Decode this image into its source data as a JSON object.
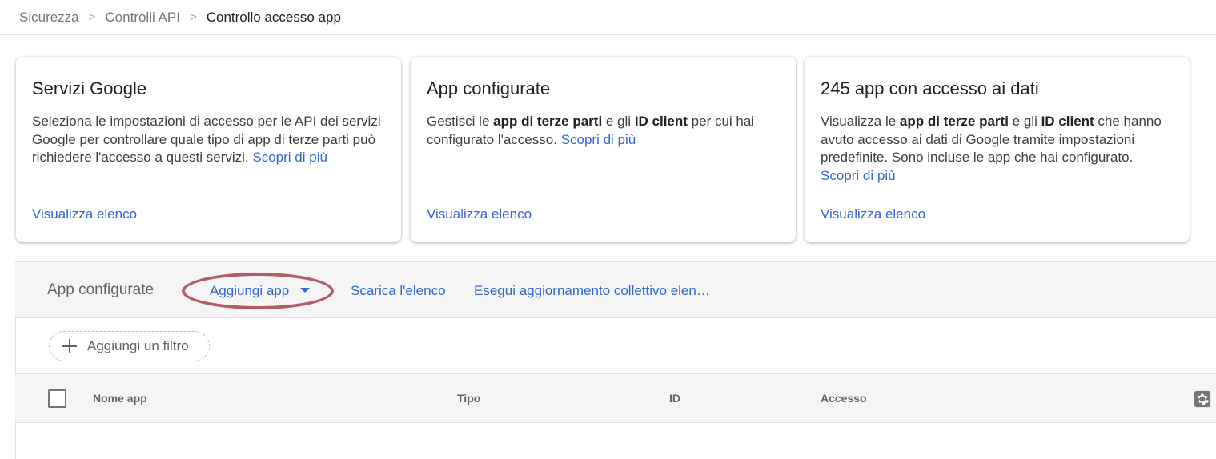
{
  "breadcrumb": {
    "items": [
      "Sicurezza",
      "Controlli API",
      "Controllo accesso app"
    ],
    "separator": ">"
  },
  "cards": [
    {
      "title": "Servizi Google",
      "body": "Seleziona le impostazioni di accesso per le API dei servizi Google per controllare quale tipo di app di terze parti può richiedere l'accesso a questi servizi.",
      "learn_more": "Scopri di più",
      "footer_link": "Visualizza elenco"
    },
    {
      "title": "App configurate",
      "body_pre": "Gestisci le ",
      "body_bold1": "app di terze parti",
      "body_mid": " e gli ",
      "body_bold2": "ID client",
      "body_post": " per cui hai configurato l'accesso.",
      "learn_more": "Scopri di più",
      "footer_link": "Visualizza elenco"
    },
    {
      "title": "245 app con accesso ai dati",
      "body_pre": "Visualizza le ",
      "body_bold1": "app di terze parti",
      "body_mid": " e gli ",
      "body_bold2": "ID client",
      "body_post": " che hanno avuto accesso ai dati di Google tramite impostazioni predefinite. Sono incluse le app che hai configurato.",
      "learn_more": "Scopri di più",
      "footer_link": "Visualizza elenco"
    }
  ],
  "panel": {
    "title": "App configurate",
    "add_app": "Aggiungi app",
    "download_list": "Scarica l'elenco",
    "bulk_update": "Esegui aggiornamento collettivo elen…"
  },
  "filter": {
    "add_filter": "Aggiungi un filtro"
  },
  "table": {
    "columns": [
      "Nome app",
      "Tipo",
      "ID",
      "Accesso"
    ]
  },
  "colors": {
    "link": "#3367d6",
    "highlight": "#b45a68",
    "panel_bg": "#f5f5f5"
  },
  "icons": {
    "breadcrumb_separator": "chevron-right-icon",
    "dropdown": "caret-down-icon",
    "filter": "plus-icon",
    "settings": "gear-icon"
  }
}
